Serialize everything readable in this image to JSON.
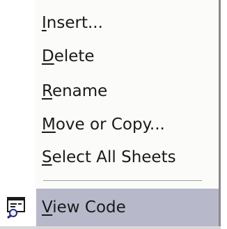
{
  "context_menu": {
    "items": [
      {
        "prefix": "",
        "mnemonic": "I",
        "rest": "nsert..."
      },
      {
        "prefix": "",
        "mnemonic": "D",
        "rest": "elete"
      },
      {
        "prefix": "",
        "mnemonic": "R",
        "rest": "ename"
      },
      {
        "prefix": "",
        "mnemonic": "M",
        "rest": "ove or Copy..."
      },
      {
        "prefix": "",
        "mnemonic": "S",
        "rest": "elect All Sheets"
      }
    ],
    "view_code": {
      "prefix": "",
      "mnemonic": "V",
      "rest": "iew Code",
      "icon": "view-code-icon",
      "highlighted": true
    }
  },
  "colors": {
    "highlight": "#b7b9ca",
    "menu_background": "#fbfbfa",
    "text": "#1a1a1a"
  }
}
